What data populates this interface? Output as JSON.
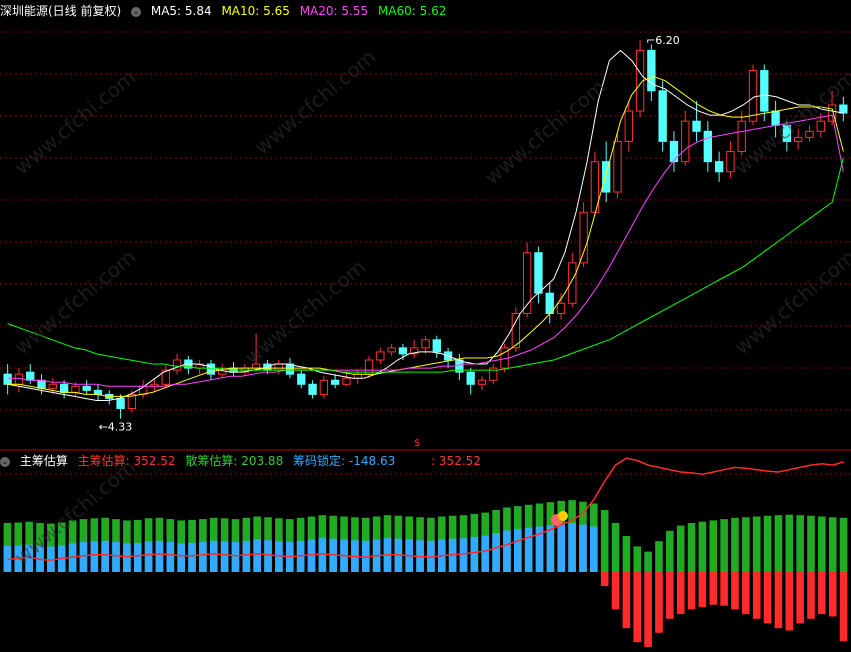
{
  "top_panel": {
    "stock_title": "深圳能源(日线 前复权)",
    "ma_labels": [
      {
        "label": "MA5: 5.84",
        "color": "#ffffff"
      },
      {
        "label": "MA10: 5.65",
        "color": "#ffff00"
      },
      {
        "label": "MA20: 5.55",
        "color": "#ff44ff"
      },
      {
        "label": "MA60: 5.62",
        "color": "#00ff00"
      }
    ],
    "high_annotation": "6.20",
    "low_annotation": "4.33",
    "signal_mark": "$"
  },
  "bottom_panel": {
    "indicator_title": "主筹估算",
    "legend": [
      {
        "label": "主筹估算: 352.52",
        "color": "#ff3333"
      },
      {
        "label": "散筹估算: 203.88",
        "color": "#33cc33"
      },
      {
        "label": "筹码锁定: -148.63",
        "color": "#33aaff"
      },
      {
        "label": ": 352.52",
        "color": "#ff3333"
      }
    ]
  },
  "watermark": "www.cfchi.com",
  "colors": {
    "up": "#ff3030",
    "down": "#55ffff",
    "grid": "#8b0000",
    "ma5": "#ffffff",
    "ma10": "#ffff00",
    "ma20": "#ff44ff",
    "ma60": "#00ff00"
  },
  "chart_data": [
    {
      "type": "candlestick",
      "title": "深圳能源(日线 前复权)",
      "ylim": [
        4.2,
        6.3
      ],
      "series": [
        {
          "name": "MA5",
          "values": [
            4.5,
            4.49,
            4.48,
            4.47,
            4.46,
            4.45,
            4.44,
            4.43,
            4.42,
            4.42,
            4.43,
            4.45,
            4.48,
            4.52,
            4.56,
            4.58,
            4.6,
            4.6,
            4.59,
            4.57,
            4.56,
            4.56,
            4.57,
            4.58,
            4.6,
            4.6,
            4.59,
            4.58,
            4.56,
            4.55,
            4.54,
            4.53,
            4.53,
            4.55,
            4.58,
            4.62,
            4.65,
            4.66,
            4.66,
            4.65,
            4.63,
            4.61,
            4.6,
            4.6,
            4.66,
            4.75,
            4.85,
            4.92,
            4.97,
            5.02,
            5.15,
            5.35,
            5.6,
            5.9,
            6.1,
            6.15,
            6.1,
            6.02,
            5.98,
            5.96,
            5.92,
            5.88,
            5.85,
            5.83,
            5.83,
            5.85,
            5.88,
            5.92,
            5.93,
            5.92,
            5.9,
            5.88,
            5.88,
            5.86,
            5.85,
            5.84
          ]
        },
        {
          "name": "MA10",
          "values": [
            4.5,
            4.5,
            4.49,
            4.48,
            4.47,
            4.46,
            4.46,
            4.45,
            4.45,
            4.44,
            4.44,
            4.44,
            4.45,
            4.46,
            4.48,
            4.5,
            4.52,
            4.54,
            4.56,
            4.57,
            4.58,
            4.58,
            4.58,
            4.58,
            4.58,
            4.58,
            4.58,
            4.58,
            4.58,
            4.57,
            4.56,
            4.55,
            4.55,
            4.55,
            4.56,
            4.57,
            4.58,
            4.59,
            4.6,
            4.61,
            4.62,
            4.63,
            4.63,
            4.63,
            4.64,
            4.67,
            4.71,
            4.76,
            4.81,
            4.87,
            4.95,
            5.05,
            5.2,
            5.4,
            5.6,
            5.8,
            5.93,
            6.0,
            6.02,
            6.0,
            5.96,
            5.92,
            5.88,
            5.85,
            5.83,
            5.82,
            5.82,
            5.83,
            5.84,
            5.85,
            5.86,
            5.87,
            5.87,
            5.87,
            5.86,
            5.65
          ]
        },
        {
          "name": "MA20",
          "values": [
            4.53,
            4.53,
            4.52,
            4.52,
            4.51,
            4.51,
            4.5,
            4.5,
            4.5,
            4.49,
            4.49,
            4.49,
            4.49,
            4.49,
            4.49,
            4.5,
            4.5,
            4.51,
            4.52,
            4.53,
            4.54,
            4.54,
            4.55,
            4.56,
            4.56,
            4.57,
            4.57,
            4.57,
            4.57,
            4.57,
            4.57,
            4.57,
            4.57,
            4.57,
            4.57,
            4.57,
            4.58,
            4.58,
            4.58,
            4.59,
            4.59,
            4.6,
            4.6,
            4.61,
            4.62,
            4.63,
            4.65,
            4.67,
            4.7,
            4.73,
            4.78,
            4.84,
            4.91,
            4.99,
            5.08,
            5.18,
            5.28,
            5.38,
            5.47,
            5.55,
            5.62,
            5.67,
            5.7,
            5.72,
            5.73,
            5.74,
            5.75,
            5.76,
            5.77,
            5.78,
            5.79,
            5.8,
            5.81,
            5.82,
            5.83,
            5.55
          ]
        },
        {
          "name": "MA60",
          "values": [
            4.8,
            4.78,
            4.76,
            4.74,
            4.72,
            4.7,
            4.68,
            4.67,
            4.65,
            4.64,
            4.63,
            4.62,
            4.61,
            4.6,
            4.6,
            4.59,
            4.59,
            4.58,
            4.58,
            4.58,
            4.57,
            4.57,
            4.57,
            4.57,
            4.57,
            4.57,
            4.57,
            4.57,
            4.57,
            4.57,
            4.56,
            4.56,
            4.56,
            4.56,
            4.56,
            4.56,
            4.56,
            4.56,
            4.56,
            4.56,
            4.57,
            4.57,
            4.57,
            4.57,
            4.57,
            4.58,
            4.59,
            4.6,
            4.61,
            4.62,
            4.64,
            4.66,
            4.68,
            4.7,
            4.72,
            4.75,
            4.78,
            4.81,
            4.84,
            4.87,
            4.9,
            4.93,
            4.96,
            4.99,
            5.02,
            5.05,
            5.08,
            5.12,
            5.16,
            5.2,
            5.24,
            5.28,
            5.32,
            5.36,
            5.4,
            5.62
          ]
        }
      ],
      "candles": [
        [
          4.55,
          4.5,
          4.6,
          4.45
        ],
        [
          4.5,
          4.55,
          4.58,
          4.46
        ],
        [
          4.56,
          4.52,
          4.6,
          4.5
        ],
        [
          4.52,
          4.48,
          4.55,
          4.45
        ],
        [
          4.48,
          4.5,
          4.53,
          4.45
        ],
        [
          4.5,
          4.46,
          4.52,
          4.43
        ],
        [
          4.46,
          4.49,
          4.51,
          4.44
        ],
        [
          4.49,
          4.47,
          4.52,
          4.45
        ],
        [
          4.47,
          4.45,
          4.5,
          4.42
        ],
        [
          4.45,
          4.43,
          4.47,
          4.4
        ],
        [
          4.43,
          4.38,
          4.45,
          4.33
        ],
        [
          4.38,
          4.45,
          4.47,
          4.36
        ],
        [
          4.45,
          4.49,
          4.52,
          4.43
        ],
        [
          4.49,
          4.5,
          4.53,
          4.46
        ],
        [
          4.5,
          4.57,
          4.59,
          4.48
        ],
        [
          4.57,
          4.62,
          4.65,
          4.55
        ],
        [
          4.62,
          4.58,
          4.64,
          4.55
        ],
        [
          4.58,
          4.6,
          4.62,
          4.55
        ],
        [
          4.6,
          4.55,
          4.62,
          4.52
        ],
        [
          4.55,
          4.58,
          4.6,
          4.53
        ],
        [
          4.58,
          4.56,
          4.61,
          4.54
        ],
        [
          4.56,
          4.58,
          4.6,
          4.54
        ],
        [
          4.58,
          4.6,
          4.75,
          4.56
        ],
        [
          4.6,
          4.57,
          4.62,
          4.55
        ],
        [
          4.57,
          4.6,
          4.62,
          4.55
        ],
        [
          4.6,
          4.55,
          4.63,
          4.53
        ],
        [
          4.55,
          4.5,
          4.57,
          4.48
        ],
        [
          4.5,
          4.45,
          4.52,
          4.43
        ],
        [
          4.45,
          4.52,
          4.54,
          4.43
        ],
        [
          4.52,
          4.5,
          4.55,
          4.48
        ],
        [
          4.5,
          4.53,
          4.56,
          4.49
        ],
        [
          4.53,
          4.55,
          4.57,
          4.5
        ],
        [
          4.55,
          4.62,
          4.64,
          4.53
        ],
        [
          4.62,
          4.66,
          4.68,
          4.6
        ],
        [
          4.66,
          4.68,
          4.7,
          4.64
        ],
        [
          4.68,
          4.65,
          4.7,
          4.62
        ],
        [
          4.65,
          4.68,
          4.72,
          4.63
        ],
        [
          4.68,
          4.72,
          4.74,
          4.65
        ],
        [
          4.72,
          4.66,
          4.74,
          4.63
        ],
        [
          4.66,
          4.62,
          4.68,
          4.58
        ],
        [
          4.62,
          4.56,
          4.65,
          4.52
        ],
        [
          4.56,
          4.5,
          4.58,
          4.45
        ],
        [
          4.5,
          4.52,
          4.54,
          4.47
        ],
        [
          4.52,
          4.58,
          4.6,
          4.5
        ],
        [
          4.58,
          4.68,
          4.7,
          4.56
        ],
        [
          4.68,
          4.85,
          4.88,
          4.66
        ],
        [
          4.85,
          5.15,
          5.2,
          4.83
        ],
        [
          5.15,
          4.95,
          5.18,
          4.9
        ],
        [
          4.95,
          4.85,
          5.0,
          4.8
        ],
        [
          4.85,
          4.9,
          4.95,
          4.82
        ],
        [
          4.9,
          5.1,
          5.15,
          4.88
        ],
        [
          5.1,
          5.35,
          5.4,
          5.08
        ],
        [
          5.35,
          5.6,
          5.65,
          5.33
        ],
        [
          5.6,
          5.45,
          5.7,
          5.4
        ],
        [
          5.45,
          5.7,
          5.75,
          5.42
        ],
        [
          5.7,
          5.85,
          5.9,
          5.65
        ],
        [
          5.85,
          6.15,
          6.2,
          5.82
        ],
        [
          6.15,
          5.95,
          6.18,
          5.9
        ],
        [
          5.95,
          5.7,
          6.0,
          5.65
        ],
        [
          5.7,
          5.6,
          5.75,
          5.55
        ],
        [
          5.6,
          5.8,
          5.85,
          5.58
        ],
        [
          5.8,
          5.75,
          5.9,
          5.7
        ],
        [
          5.75,
          5.6,
          5.8,
          5.55
        ],
        [
          5.6,
          5.55,
          5.65,
          5.5
        ],
        [
          5.55,
          5.65,
          5.7,
          5.52
        ],
        [
          5.65,
          5.8,
          5.85,
          5.63
        ],
        [
          5.8,
          6.05,
          6.08,
          5.78
        ],
        [
          6.05,
          5.85,
          6.08,
          5.8
        ],
        [
          5.85,
          5.78,
          5.9,
          5.72
        ],
        [
          5.78,
          5.7,
          5.8,
          5.65
        ],
        [
          5.7,
          5.72,
          5.76,
          5.66
        ],
        [
          5.72,
          5.75,
          5.78,
          5.7
        ],
        [
          5.75,
          5.8,
          5.84,
          5.72
        ],
        [
          5.8,
          5.88,
          5.95,
          5.78
        ],
        [
          5.88,
          5.84,
          5.92,
          5.8
        ]
      ]
    },
    {
      "type": "bar",
      "title": "主筹估算",
      "ylim": [
        -180,
        240
      ],
      "series": [
        {
          "name": "散筹估算",
          "values": [
            150,
            152,
            155,
            150,
            148,
            152,
            160,
            165,
            168,
            170,
            165,
            160,
            162,
            168,
            170,
            165,
            160,
            162,
            165,
            170,
            168,
            165,
            170,
            175,
            172,
            168,
            165,
            170,
            175,
            180,
            178,
            175,
            172,
            170,
            175,
            180,
            178,
            175,
            172,
            170,
            175,
            178,
            180,
            185,
            190,
            200,
            210,
            215,
            220,
            225,
            230,
            235,
            238,
            232,
            225,
            200,
            150,
            100,
            60,
            40,
            80,
            120,
            140,
            150,
            155,
            160,
            165,
            170,
            172,
            175,
            178,
            180,
            182,
            180,
            178,
            175,
            172,
            170
          ]
        },
        {
          "name": "筹码锁定",
          "values": [
            100,
            102,
            105,
            100,
            98,
            102,
            110,
            115,
            118,
            120,
            115,
            110,
            112,
            118,
            120,
            115,
            110,
            112,
            115,
            120,
            118,
            115,
            120,
            125,
            122,
            118,
            115,
            120,
            125,
            130,
            128,
            125,
            122,
            120,
            125,
            130,
            128,
            125,
            122,
            120,
            125,
            128,
            130,
            135,
            140,
            150,
            160,
            165,
            170,
            175,
            180,
            185,
            188,
            182,
            175,
            -30,
            -80,
            -120,
            -150,
            -160,
            -130,
            -100,
            -90,
            -80,
            -75,
            -70,
            -72,
            -80,
            -90,
            -100,
            -110,
            -120,
            -125,
            -110,
            -100,
            -90,
            -95,
            -148
          ]
        },
        {
          "name": "主筹估算",
          "values": [
            340,
            342,
            345,
            340,
            338,
            342,
            345,
            348,
            350,
            350,
            348,
            346,
            348,
            350,
            352,
            350,
            348,
            348,
            350,
            352,
            350,
            348,
            350,
            352,
            350,
            348,
            346,
            348,
            350,
            352,
            350,
            348,
            346,
            345,
            348,
            350,
            350,
            348,
            346,
            345,
            348,
            350,
            352,
            355,
            358,
            365,
            372,
            380,
            388,
            395,
            405,
            415,
            425,
            440,
            470,
            510,
            545,
            560,
            555,
            545,
            540,
            535,
            530,
            528,
            525,
            530,
            535,
            540,
            538,
            535,
            532,
            530,
            535,
            540,
            545,
            548,
            545,
            552
          ]
        }
      ]
    }
  ]
}
